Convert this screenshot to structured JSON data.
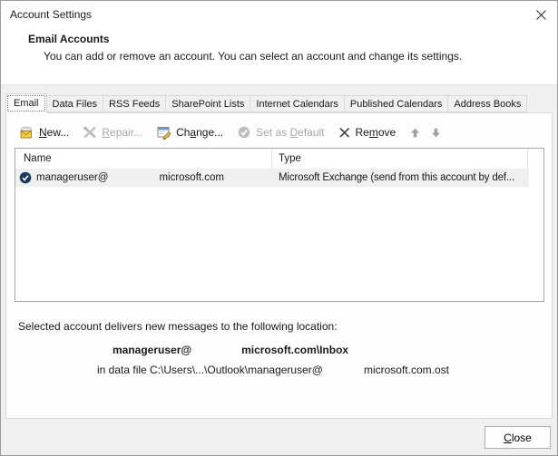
{
  "window": {
    "title": "Account Settings"
  },
  "banner": {
    "title": "Email Accounts",
    "description": "You can add or remove an account. You can select an account and change its settings."
  },
  "tabs": [
    {
      "label": "Email",
      "active": true
    },
    {
      "label": "Data Files"
    },
    {
      "label": "RSS Feeds"
    },
    {
      "label": "SharePoint Lists"
    },
    {
      "label": "Internet Calendars"
    },
    {
      "label": "Published Calendars"
    },
    {
      "label": "Address Books"
    }
  ],
  "toolbar": {
    "new": {
      "pre": "",
      "key": "N",
      "post": "ew...",
      "enabled": true
    },
    "repair": {
      "pre": "",
      "key": "R",
      "post": "epair...",
      "enabled": false
    },
    "change": {
      "pre": "Ch",
      "key": "a",
      "post": "nge...",
      "enabled": true
    },
    "set_default": {
      "pre": "Set as ",
      "key": "D",
      "post": "efault",
      "enabled": false
    },
    "remove": {
      "pre": "Re",
      "key": "m",
      "post": "ove",
      "enabled": true
    }
  },
  "accounts": {
    "columns": {
      "name": "Name",
      "type": "Type"
    },
    "rows": [
      {
        "name_user": "manageruser@",
        "name_domain": "microsoft.com",
        "type": "Microsoft Exchange (send from this account by def...",
        "is_default": true
      }
    ]
  },
  "footer": {
    "location_label": "Selected account delivers new messages to the following location:",
    "account_user": "manageruser@",
    "account_path": "microsoft.com\\Inbox",
    "datafile_prefix": "in data file C:\\Users\\...\\Outlook\\manageruser@",
    "datafile_suffix": "microsoft.com.ost"
  },
  "buttons": {
    "close_pre": "",
    "close_key": "C",
    "close_post": "lose"
  },
  "colors": {
    "dialog_bg": "#f0f0f0",
    "panel_bg": "#fdfdfd",
    "row_highlight": "#efefef",
    "disabled_text": "#a8a8a8",
    "default_badge": "#1a3a5c",
    "envelope_yellow": "#f6cf3f"
  }
}
